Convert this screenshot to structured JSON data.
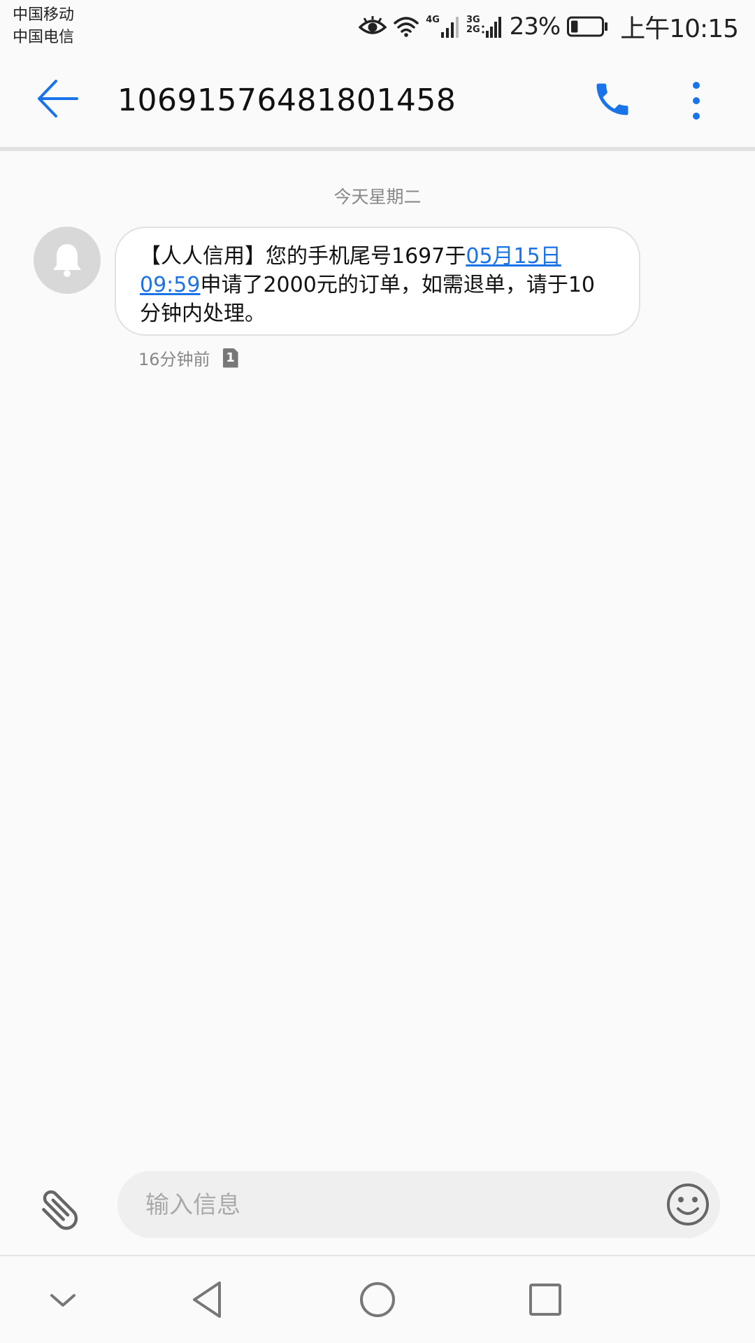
{
  "status_bar": {
    "carrier_1": "中国移动",
    "carrier_2": "中国电信",
    "network_1": "4G",
    "network_2a": "3G",
    "network_2b": "2G",
    "battery_percent": "23%",
    "battery_level": 0.23,
    "time": "上午10:15",
    "icons": [
      "eye-comfort-icon",
      "wifi-icon",
      "signal-icon",
      "battery-icon"
    ]
  },
  "header": {
    "contact": "10691576481801458",
    "icons": [
      "back-arrow-icon",
      "phone-icon",
      "more-vertical-icon"
    ],
    "accent_color": "#1a73e8"
  },
  "conversation": {
    "date_separator": "今天星期二",
    "message": {
      "text_before_link": "【人人信用】您的手机尾号1697于",
      "link": "05月15日09:59",
      "text_after_link": "申请了2000元的订单，如需退单，请于10分钟内处理。",
      "time_ago": "16分钟前",
      "sim": "1"
    }
  },
  "composer": {
    "placeholder": "输入信息",
    "icons": [
      "paperclip-icon",
      "emoji-icon"
    ]
  },
  "nav_bar": {
    "icons": [
      "hide-keyboard-icon",
      "nav-back-icon",
      "nav-home-icon",
      "nav-recents-icon"
    ]
  }
}
